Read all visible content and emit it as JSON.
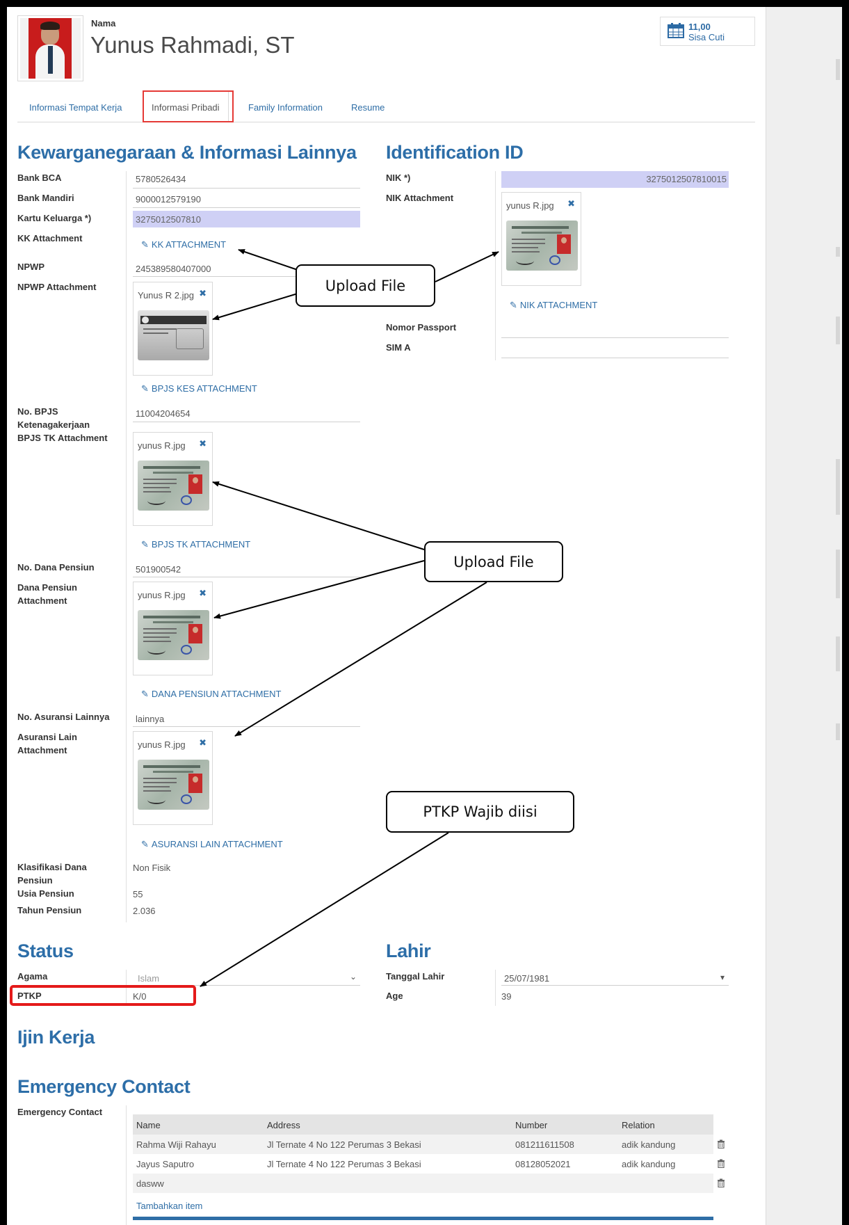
{
  "header": {
    "name_label": "Nama",
    "employee_name": "Yunus Rahmadi, ST",
    "leave_value": "11,00",
    "leave_label": "Sisa Cuti"
  },
  "tabs": [
    {
      "label": "Informasi Tempat Kerja",
      "active": false
    },
    {
      "label": "Informasi Pribadi",
      "active": true
    },
    {
      "label": "Family Information",
      "active": false
    },
    {
      "label": "Resume",
      "active": false
    }
  ],
  "citizenship": {
    "title": "Kewarganegaraan & Informasi Lainnya",
    "bank_bca_label": "Bank BCA",
    "bank_bca_value": "5780526434",
    "bank_mandiri_label": "Bank Mandiri",
    "bank_mandiri_value": "9000012579190",
    "kk_label": "Kartu Keluarga *)",
    "kk_value": "3275012507810",
    "kk_attachment_label": "KK Attachment",
    "kk_attachment_link": "KK ATTACHMENT",
    "npwp_label": "NPWP",
    "npwp_value": "245389580407000",
    "npwp_attachment_label": "NPWP Attachment",
    "npwp_file": "Yunus R 2.jpg",
    "bpjs_kes_link": "BPJS KES ATTACHMENT",
    "bpjs_tk_label": "No. BPJS Ketenagakerjaan",
    "bpjs_tk_value": "11004204654",
    "bpjs_tk_attachment_label": "BPJS TK Attachment",
    "bpjs_tk_file": "yunus R.jpg",
    "bpjs_tk_link": "BPJS TK ATTACHMENT",
    "dana_pensiun_label": "No. Dana Pensiun",
    "dana_pensiun_value": "501900542",
    "dana_pensiun_attachment_label": "Dana Pensiun Attachment",
    "dana_pensiun_file": "yunus R.jpg",
    "dana_pensiun_link": "DANA PENSIUN ATTACHMENT",
    "asuransi_label": "No. Asuransi Lainnya",
    "asuransi_value": "lainnya",
    "asuransi_attachment_label": "Asuransi Lain Attachment",
    "asuransi_file": "yunus R.jpg",
    "asuransi_link": "ASURANSI LAIN ATTACHMENT",
    "klasifikasi_label": "Klasifikasi Dana Pensiun",
    "klasifikasi_value": "Non Fisik",
    "usia_label": "Usia Pensiun",
    "usia_value": "55",
    "tahun_label": "Tahun Pensiun",
    "tahun_value": "2.036"
  },
  "identification": {
    "title": "Identification ID",
    "nik_label": "NIK *)",
    "nik_value": "3275012507810015",
    "nik_attachment_label": "NIK Attachment",
    "nik_file": "yunus R.jpg",
    "nik_link": "NIK ATTACHMENT",
    "passport_label": "Nomor Passport",
    "sim_label": "SIM A"
  },
  "status": {
    "title": "Status",
    "agama_label": "Agama",
    "agama_value": "Islam",
    "ptkp_label": "PTKP",
    "ptkp_value": "K/0"
  },
  "lahir": {
    "title": "Lahir",
    "tanggal_label": "Tanggal Lahir",
    "tanggal_value": "25/07/1981",
    "age_label": "Age",
    "age_value": "39"
  },
  "ijin_kerja": {
    "title": "Ijin Kerja"
  },
  "emergency": {
    "title": "Emergency Contact",
    "field_label": "Emergency Contact",
    "columns": [
      "Name",
      "Address",
      "Number",
      "Relation"
    ],
    "rows": [
      {
        "name": "Rahma Wiji Rahayu",
        "address": "Jl Ternate 4 No 122 Perumas 3 Bekasi",
        "number": "081211611508",
        "relation": "adik kandung"
      },
      {
        "name": "Jayus Saputro",
        "address": "Jl Ternate 4 No 122 Perumas 3 Bekasi",
        "number": "08128052021",
        "relation": "adik kandung"
      },
      {
        "name": "dasww",
        "address": "",
        "number": "",
        "relation": ""
      }
    ],
    "add_item": "Tambahkan item"
  },
  "annotations": {
    "callout_upload_1": "Upload File",
    "callout_upload_2": "Upload File",
    "callout_ptkp": "PTKP Wajib diisi",
    "highlight_color": "#e41a1a"
  },
  "icons": {
    "leave": "calendar-icon",
    "attachment": "paperclip-icon",
    "remove": "close-icon",
    "delete": "trash-icon",
    "dropdown": "chevron-down-icon"
  }
}
